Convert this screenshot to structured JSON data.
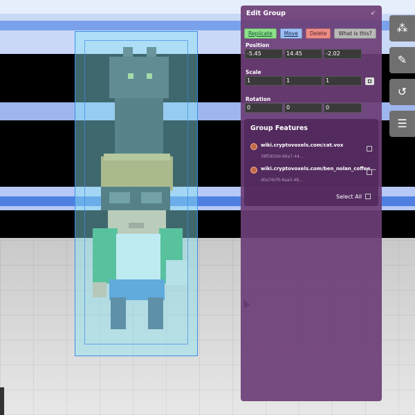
{
  "panel": {
    "title": "Edit Group",
    "collapse_icon": "collapse-icon",
    "buttons": {
      "replicate": "Replicate",
      "move": "Move",
      "delete": "Delete",
      "what": "What is this?"
    },
    "position": {
      "label": "Position",
      "x": "-5.45",
      "y": "14.45",
      "z": "-2.02"
    },
    "scale": {
      "label": "Scale",
      "x": "1",
      "y": "1",
      "z": "1"
    },
    "rotation": {
      "label": "Rotation",
      "x": "0",
      "y": "0",
      "z": "0"
    }
  },
  "features": {
    "title": "Group Features",
    "items": [
      {
        "url": "wiki.cryptovoxels.com/cat.vox",
        "id": "38f5830d-66a7-44..."
      },
      {
        "url": "wiki.cryptovoxels.com/ben_nolan_coffee...",
        "id": "d0a76cf0-6aa5-48..."
      }
    ],
    "select_all": "Select All"
  },
  "toolbar": [
    "objects-icon",
    "brush-icon",
    "history-icon",
    "list-icon"
  ],
  "colors": {
    "panel": "#6c3e76",
    "replicate": "#8ee08a",
    "move": "#9cc0f5",
    "delete": "#ec8c86"
  }
}
